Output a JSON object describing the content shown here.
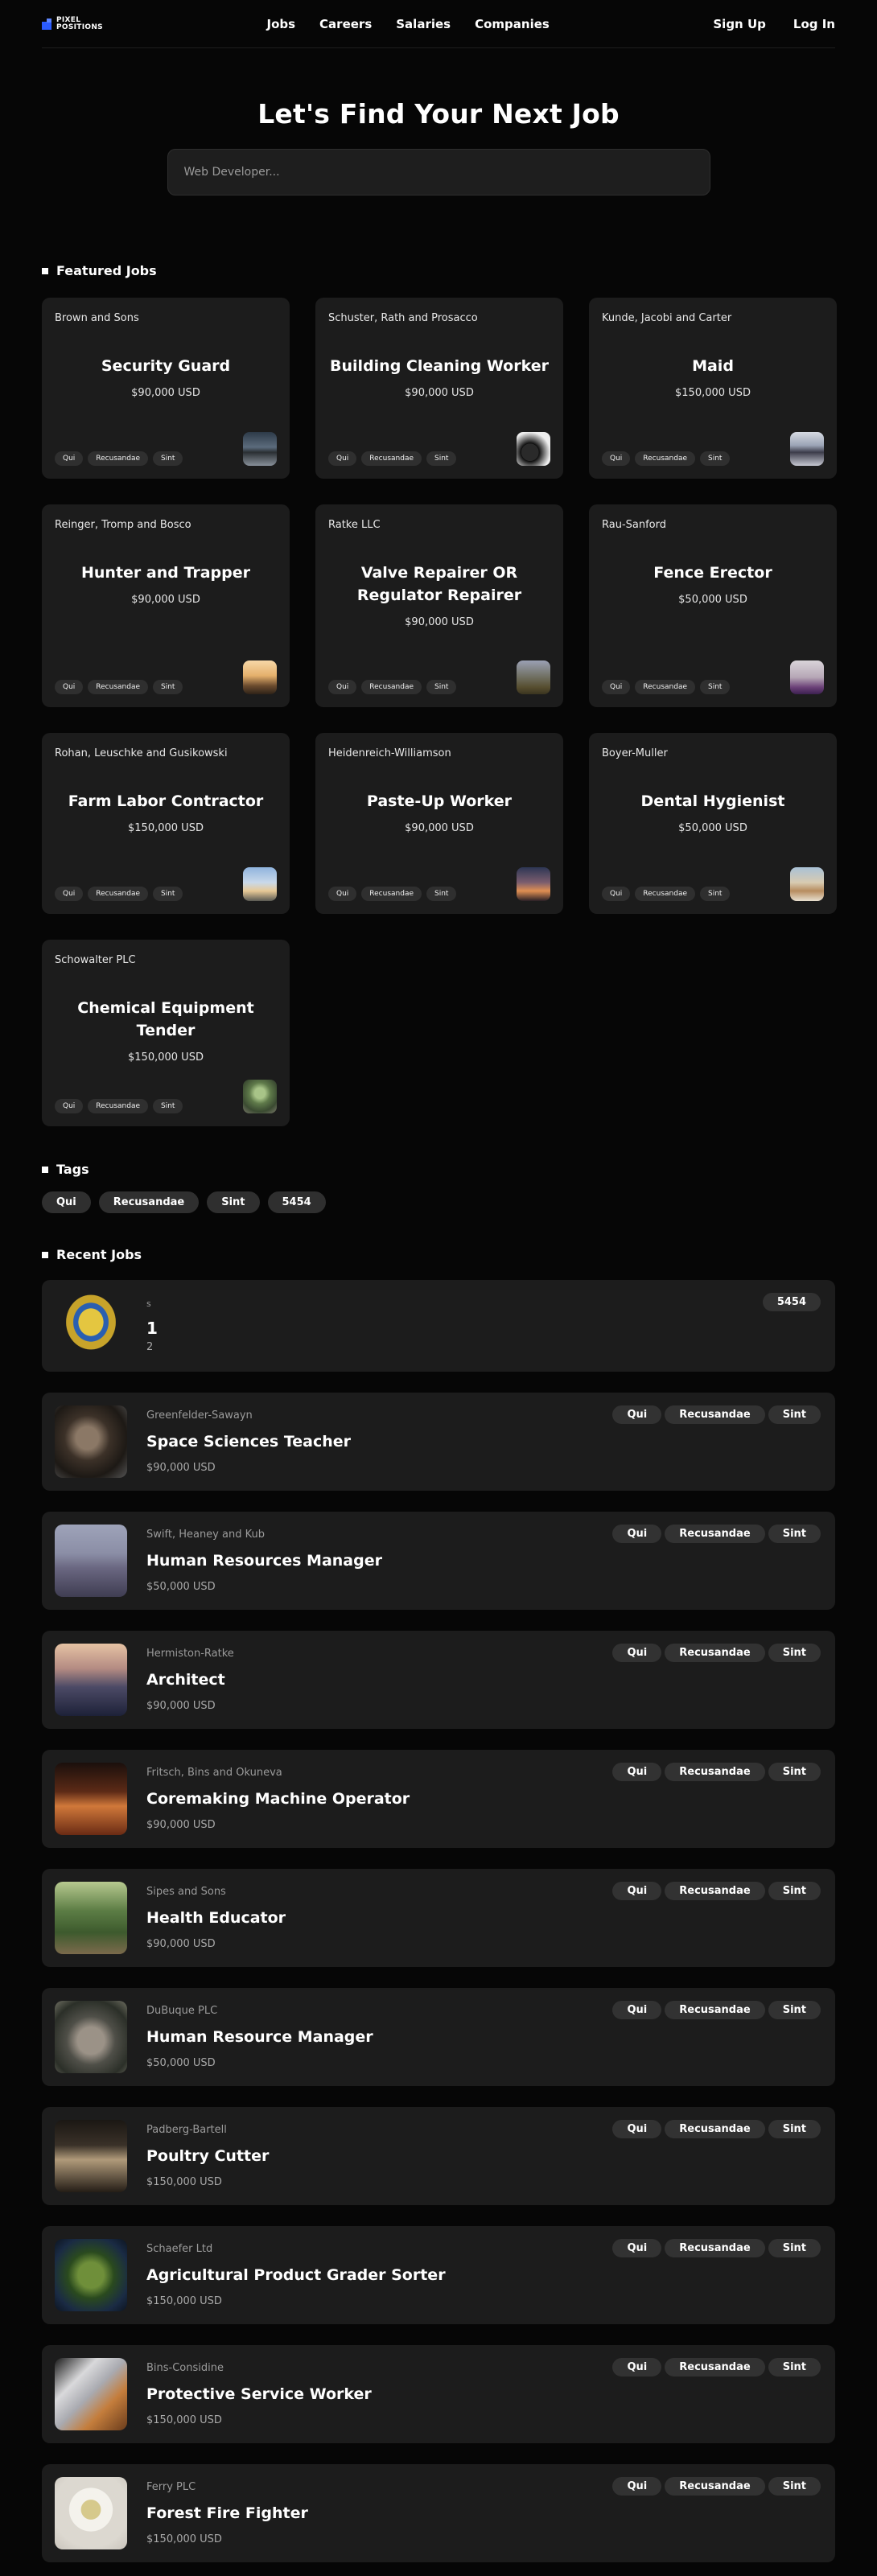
{
  "brand": {
    "line1": "PIXEL",
    "line2": "POSITIONS"
  },
  "nav": {
    "links": [
      "Jobs",
      "Careers",
      "Salaries",
      "Companies"
    ],
    "signup": "Sign Up",
    "login": "Log In"
  },
  "hero": {
    "title": "Let's Find Your Next Job",
    "search_placeholder": "Web Developer..."
  },
  "featured": {
    "heading": "Featured Jobs",
    "jobs": [
      {
        "employer": "Brown and Sons",
        "title": "Security Guard",
        "salary": "$90,000 USD",
        "tags": [
          "Qui",
          "Recusandae",
          "Sint"
        ],
        "image": "road-night-thumb"
      },
      {
        "employer": "Schuster, Rath and Prosacco",
        "title": "Building Cleaning Worker",
        "salary": "$90,000 USD",
        "tags": [
          "Qui",
          "Recusandae",
          "Sint"
        ],
        "image": "camera-thumb"
      },
      {
        "employer": "Kunde, Jacobi and Carter",
        "title": "Maid",
        "salary": "$150,000 USD",
        "tags": [
          "Qui",
          "Recusandae",
          "Sint"
        ],
        "image": "lake-thumb"
      },
      {
        "employer": "Reinger, Tromp and Bosco",
        "title": "Hunter and Trapper",
        "salary": "$90,000 USD",
        "tags": [
          "Qui",
          "Recusandae",
          "Sint"
        ],
        "image": "sunset-thumb"
      },
      {
        "employer": "Ratke LLC",
        "title": "Valve Repairer OR Regulator Repairer",
        "salary": "$90,000 USD",
        "tags": [
          "Qui",
          "Recusandae",
          "Sint"
        ],
        "image": "field-thumb"
      },
      {
        "employer": "Rau-Sanford",
        "title": "Fence Erector",
        "salary": "$50,000 USD",
        "tags": [
          "Qui",
          "Recusandae",
          "Sint"
        ],
        "image": "lavender-thumb"
      },
      {
        "employer": "Rohan, Leuschke and Gusikowski",
        "title": "Farm Labor Contractor",
        "salary": "$150,000 USD",
        "tags": [
          "Qui",
          "Recusandae",
          "Sint"
        ],
        "image": "sky-thumb"
      },
      {
        "employer": "Heidenreich-Williamson",
        "title": "Paste-Up Worker",
        "salary": "$90,000 USD",
        "tags": [
          "Qui",
          "Recusandae",
          "Sint"
        ],
        "image": "dusk-thumb"
      },
      {
        "employer": "Boyer-Muller",
        "title": "Dental Hygienist",
        "salary": "$50,000 USD",
        "tags": [
          "Qui",
          "Recusandae",
          "Sint"
        ],
        "image": "beach-thumb"
      },
      {
        "employer": "Schowalter PLC",
        "title": "Chemical Equipment Tender",
        "salary": "$150,000 USD",
        "tags": [
          "Qui",
          "Recusandae",
          "Sint"
        ],
        "image": "forest-thumb"
      }
    ]
  },
  "tags": {
    "heading": "Tags",
    "items": [
      "Qui",
      "Recusandae",
      "Sint",
      "5454"
    ]
  },
  "recent": {
    "heading": "Recent Jobs",
    "jobs": [
      {
        "employer": "s",
        "title": "1",
        "salary": "2",
        "tags": [
          "5454"
        ],
        "image": "emblem-thumb"
      },
      {
        "employer": "Greenfelder-Sawayn",
        "title": "Space Sciences Teacher",
        "salary": "$90,000 USD",
        "tags": [
          "Qui",
          "Recusandae",
          "Sint"
        ],
        "image": "wolf-thumb"
      },
      {
        "employer": "Swift, Heaney and Kub",
        "title": "Human Resources Manager",
        "salary": "$50,000 USD",
        "tags": [
          "Qui",
          "Recusandae",
          "Sint"
        ],
        "image": "misty-lake-thumb"
      },
      {
        "employer": "Hermiston-Ratke",
        "title": "Architect",
        "salary": "$90,000 USD",
        "tags": [
          "Qui",
          "Recusandae",
          "Sint"
        ],
        "image": "person-sunset-thumb"
      },
      {
        "employer": "Fritsch, Bins and Okuneva",
        "title": "Coremaking Machine Operator",
        "salary": "$90,000 USD",
        "tags": [
          "Qui",
          "Recusandae",
          "Sint"
        ],
        "image": "desert-thumb"
      },
      {
        "employer": "Sipes and Sons",
        "title": "Health Educator",
        "salary": "$90,000 USD",
        "tags": [
          "Qui",
          "Recusandae",
          "Sint"
        ],
        "image": "forest-path-thumb"
      },
      {
        "employer": "DuBuque PLC",
        "title": "Human Resource Manager",
        "salary": "$50,000 USD",
        "tags": [
          "Qui",
          "Recusandae",
          "Sint"
        ],
        "image": "wolf-forest-thumb"
      },
      {
        "employer": "Padberg-Bartell",
        "title": "Poultry Cutter",
        "salary": "$150,000 USD",
        "tags": [
          "Qui",
          "Recusandae",
          "Sint"
        ],
        "image": "car-thumb"
      },
      {
        "employer": "Schaefer Ltd",
        "title": "Agricultural Product Grader Sorter",
        "salary": "$150,000 USD",
        "tags": [
          "Qui",
          "Recusandae",
          "Sint"
        ],
        "image": "plant-thumb"
      },
      {
        "employer": "Bins-Considine",
        "title": "Protective Service Worker",
        "salary": "$150,000 USD",
        "tags": [
          "Qui",
          "Recusandae",
          "Sint"
        ],
        "image": "laptop-thumb"
      },
      {
        "employer": "Ferry PLC",
        "title": "Forest Fire Fighter",
        "salary": "$150,000 USD",
        "tags": [
          "Qui",
          "Recusandae",
          "Sint"
        ],
        "image": "tea-cup-thumb"
      }
    ]
  }
}
